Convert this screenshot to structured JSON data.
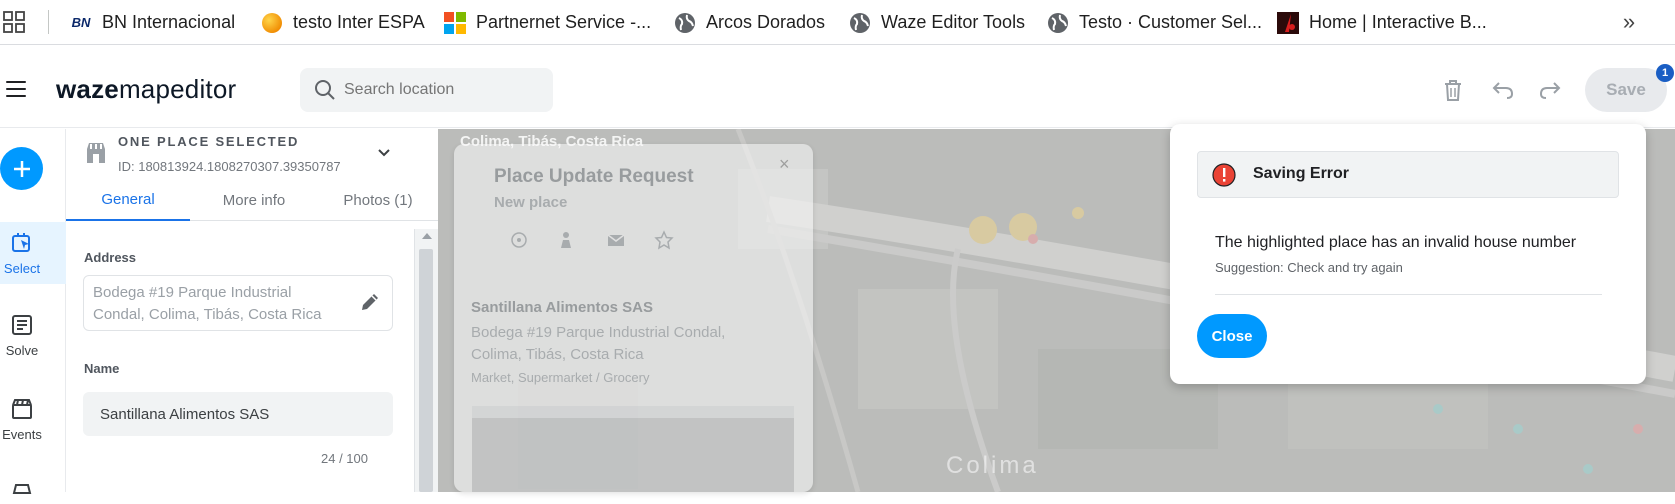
{
  "bookmarks": [
    {
      "label": "BN Internacional",
      "icon": "bn-logo-icon"
    },
    {
      "label": "testo Inter ESPA",
      "icon": "orange-circle-icon"
    },
    {
      "label": "Partnernet Service -...",
      "icon": "microsoft-logo-icon"
    },
    {
      "label": "Arcos Dorados",
      "icon": "globe-icon"
    },
    {
      "label": "Waze Editor Tools",
      "icon": "globe-icon"
    },
    {
      "label": "Testo · Customer Sel...",
      "icon": "globe-icon"
    },
    {
      "label": "Home | Interactive B...",
      "icon": "interactive-brokers-icon"
    }
  ],
  "bookmarks_more": "»",
  "header": {
    "logo_bold": "waze",
    "logo_rest": "mapeditor",
    "search_placeholder": "Search location",
    "save_label": "Save",
    "save_badge": "1"
  },
  "toolbar": {
    "select": "Select",
    "solve": "Solve",
    "events": "Events"
  },
  "panel": {
    "title": "ONE PLACE SELECTED",
    "id": "ID: 180813924.1808270307.39350787",
    "tabs": [
      "General",
      "More info",
      "Photos (1)"
    ],
    "address_label": "Address",
    "address_line1": "Bodega #19 Parque Industrial",
    "address_line2": "Condal, Colima, Tibás, Costa Rica",
    "name_label": "Name",
    "name_value": "Santillana Alimentos SAS",
    "name_count": "24 / 100"
  },
  "map": {
    "location": "Colima, Tibás, Costa Rica",
    "city_label": "Colima"
  },
  "place_update_request": {
    "close": "×",
    "title": "Place Update Request",
    "subtitle": "New place",
    "business_name": "Santillana Alimentos SAS",
    "address": "Bodega #19 Parque Industrial Condal, Colima, Tibás, Costa Rica",
    "category": "Market, Supermarket / Grocery"
  },
  "saving_error": {
    "title": "Saving Error",
    "message": "The highlighted place has an invalid house number",
    "suggestion": "Suggestion: Check and try again",
    "close_label": "Close"
  },
  "colors": {
    "accent": "#0099ff",
    "tab_active": "#1a73e8",
    "error": "#ea4335"
  }
}
